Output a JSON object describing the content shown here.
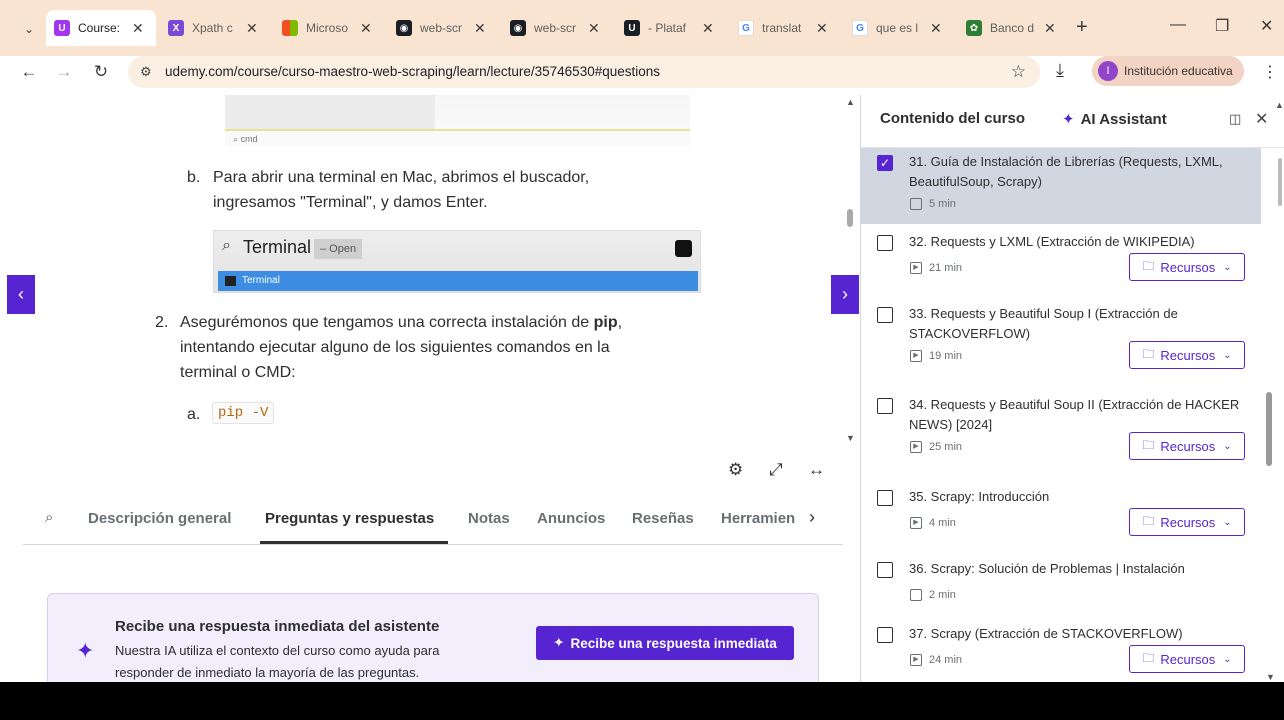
{
  "browser": {
    "tabs": [
      {
        "label": "Course:",
        "favicon_color": "#a435f0",
        "favicon_glyph": "U",
        "active": true
      },
      {
        "label": "Xpath c",
        "favicon_color": "#7a4ad6",
        "favicon_glyph": "X",
        "active": false
      },
      {
        "label": "Microso",
        "favicon_color": "#f25022",
        "favicon_glyph": "",
        "active": false
      },
      {
        "label": "web-scr",
        "favicon_color": "#1b1f23",
        "favicon_glyph": "◉",
        "active": false
      },
      {
        "label": "web-scr",
        "favicon_color": "#1b1f23",
        "favicon_glyph": "◉",
        "active": false
      },
      {
        "label": "- Plataf",
        "favicon_color": "#1b1f23",
        "favicon_glyph": "U",
        "active": false
      },
      {
        "label": "translat",
        "favicon_color": "#ffffff",
        "favicon_glyph": "G",
        "active": false
      },
      {
        "label": "que es l",
        "favicon_color": "#ffffff",
        "favicon_glyph": "G",
        "active": false
      },
      {
        "label": "Banco d",
        "favicon_color": "#2e7d32",
        "favicon_glyph": "✿",
        "active": false
      }
    ],
    "url": "udemy.com/course/curso-maestro-web-scraping/learn/lecture/35746530#questions",
    "profile_initial": "I",
    "profile_label": "Institución educativa"
  },
  "lecture": {
    "img_search_text": "cmd",
    "step_b_letter": "b.",
    "step_b_text_1": "Para abrir una terminal en Mac, abrimos el buscador,",
    "step_b_text_2": "ingresamos \"Terminal\", y damos Enter.",
    "term_title": "Terminal",
    "term_open": "– Open",
    "term_selected": "Terminal",
    "step_2_num": "2.",
    "step_2_line1_pre": "Asegurémonos que tengamos una correcta instalación de ",
    "step_2_line1_bold": "pip",
    "step_2_line1_post": ",",
    "step_2_line2": "intentando ejecutar alguno de los siguientes comandos en la",
    "step_2_line3": "terminal o CMD:",
    "step_a_letter": "a.",
    "step_a_code": "pip -V"
  },
  "course_tabs": {
    "items": [
      "Descripción general",
      "Preguntas y respuestas",
      "Notas",
      "Anuncios",
      "Reseñas",
      "Herramien"
    ],
    "active_index": 1
  },
  "assistant": {
    "heading": "Recibe una respuesta inmediata del asistente",
    "body": "Nuestra IA utiliza el contexto del curso como ayuda para responder de inmediato la mayoría de las preguntas.",
    "button": "Recibe una respuesta inmediata"
  },
  "sidebar": {
    "title": "Contenido del curso",
    "ai_tab": "AI Assistant",
    "lectures": [
      {
        "title": "31. Guía de Instalación de Librerías (Requests, LXML, BeautifulSoup, Scrapy)",
        "duration": "5 min",
        "checked": true,
        "current": true,
        "type": "article",
        "resources": false
      },
      {
        "title": "32. Requests y LXML (Extracción de WIKIPEDIA)",
        "duration": "21 min",
        "checked": false,
        "current": false,
        "type": "video",
        "resources": true
      },
      {
        "title": "33. Requests y Beautiful Soup I (Extracción de STACKOVERFLOW)",
        "duration": "19 min",
        "checked": false,
        "current": false,
        "type": "video",
        "resources": true
      },
      {
        "title": "34. Requests y Beautiful Soup II (Extracción de HACKER NEWS) [2024]",
        "duration": "25 min",
        "checked": false,
        "current": false,
        "type": "video",
        "resources": true
      },
      {
        "title": "35. Scrapy: Introducción",
        "duration": "4 min",
        "checked": false,
        "current": false,
        "type": "video",
        "resources": true
      },
      {
        "title": "36. Scrapy: Solución de Problemas | Instalación",
        "duration": "2 min",
        "checked": false,
        "current": false,
        "type": "article",
        "resources": false
      },
      {
        "title": "37. Scrapy (Extracción de STACKOVERFLOW)",
        "duration": "24 min",
        "checked": false,
        "current": false,
        "type": "video",
        "resources": true
      }
    ],
    "resources_label": "Recursos"
  }
}
